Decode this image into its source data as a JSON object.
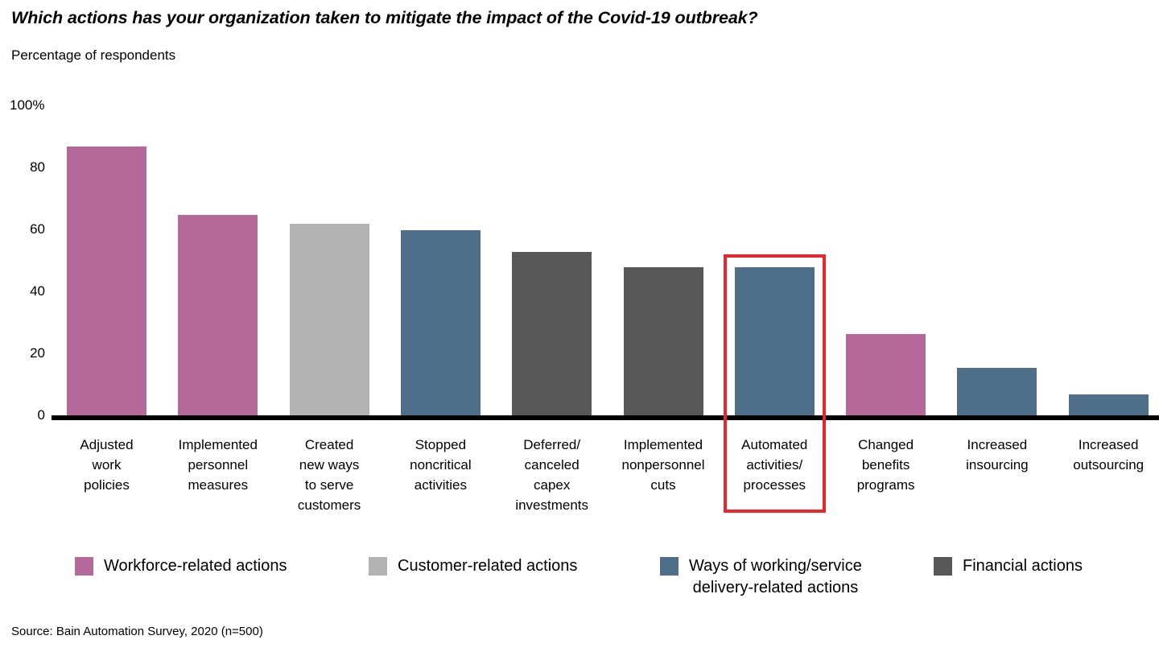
{
  "header": {
    "title": "Which actions has your organization taken to mitigate the impact of the Covid-19 outbreak?",
    "subtitle": "Percentage of respondents"
  },
  "source": {
    "text": "Source: Bain Automation Survey, 2020 (n=500)"
  },
  "colors": {
    "workforce": "#b5699b",
    "customer": "#b2b2b2",
    "ways_of_working": "#4f6e8a",
    "financial": "#575757",
    "highlight": "#e8262b",
    "axis": "#000000",
    "background": "#ffffff"
  },
  "legend": {
    "items": [
      {
        "label": "Workforce-related actions",
        "color": "#b5699b",
        "key": "workforce"
      },
      {
        "label": "Customer-related actions",
        "color": "#b2b2b2",
        "key": "customer"
      },
      {
        "label": "Ways of working/service\ndelivery-related actions",
        "color": "#4f6e8a",
        "key": "ways_of_working"
      },
      {
        "label": "Financial actions",
        "color": "#575757",
        "key": "financial"
      }
    ]
  },
  "highlight": {
    "category": "Automated activities/ processes",
    "note": "red outline around the Automated activities/processes bar and its label"
  },
  "chart_data": {
    "type": "bar",
    "title": "Which actions has your organization taken to mitigate the impact of the Covid-19 outbreak?",
    "subtitle": "Percentage of respondents",
    "xlabel": "",
    "ylabel": "Percentage of respondents",
    "ylim": [
      0,
      100
    ],
    "yticks": [
      0,
      20,
      40,
      60,
      80,
      100
    ],
    "ytick_labels": [
      "0",
      "20",
      "40",
      "60",
      "80",
      "100%"
    ],
    "grid": false,
    "legend_position": "bottom",
    "categories": [
      "Adjusted work policies",
      "Implemented personnel measures",
      "Created new ways to serve customers",
      "Stopped noncritical activities",
      "Deferred/ canceled capex investments",
      "Implemented nonpersonnel cuts",
      "Automated activities/ processes",
      "Changed benefits programs",
      "Increased insourcing",
      "Increased outsourcing"
    ],
    "category_lines": [
      [
        "Adjusted",
        "work",
        "policies"
      ],
      [
        "Implemented",
        "personnel",
        "measures"
      ],
      [
        "Created",
        "new ways",
        "to serve",
        "customers"
      ],
      [
        "Stopped",
        "noncritical",
        "activities"
      ],
      [
        "Deferred/",
        "canceled",
        "capex",
        "investments"
      ],
      [
        "Implemented",
        "nonpersonnel",
        "cuts"
      ],
      [
        "Automated",
        "activities/",
        "processes"
      ],
      [
        "Changed",
        "benefits",
        "programs"
      ],
      [
        "Increased",
        "insourcing"
      ],
      [
        "Increased",
        "outsourcing"
      ]
    ],
    "values": [
      87,
      65,
      62,
      60,
      53,
      48,
      48,
      26.5,
      15.5,
      7
    ],
    "bar_colors": [
      "#b5699b",
      "#b5699b",
      "#b2b2b2",
      "#4f6e8a",
      "#575757",
      "#575757",
      "#4f6e8a",
      "#b5699b",
      "#4f6e8a",
      "#4f6e8a"
    ],
    "bar_series": [
      "Workforce-related actions",
      "Workforce-related actions",
      "Customer-related actions",
      "Ways of working/service delivery-related actions",
      "Financial actions",
      "Financial actions",
      "Ways of working/service delivery-related actions",
      "Workforce-related actions",
      "Ways of working/service delivery-related actions",
      "Ways of working/service delivery-related actions"
    ],
    "highlighted_index": 6,
    "series": [
      {
        "name": "Percentage of respondents",
        "values": [
          87,
          65,
          62,
          60,
          53,
          48,
          48,
          26.5,
          15.5,
          7
        ]
      }
    ]
  }
}
